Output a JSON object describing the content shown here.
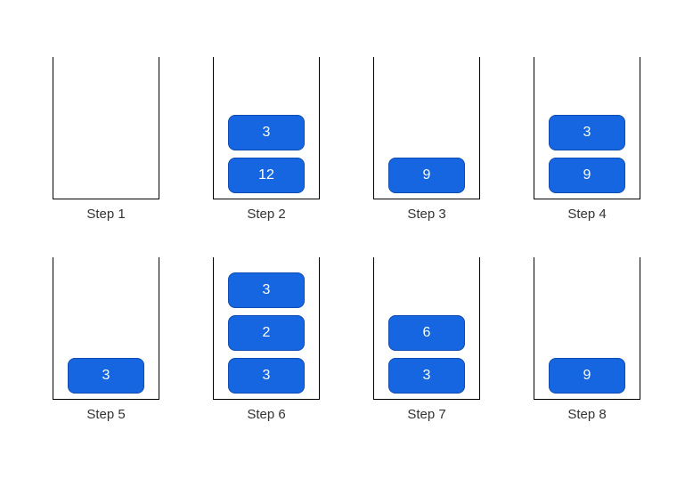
{
  "steps": [
    {
      "label": "Step 1",
      "stack": []
    },
    {
      "label": "Step 2",
      "stack": [
        12,
        3
      ]
    },
    {
      "label": "Step 3",
      "stack": [
        9
      ]
    },
    {
      "label": "Step 4",
      "stack": [
        9,
        3
      ]
    },
    {
      "label": "Step 5",
      "stack": [
        3
      ]
    },
    {
      "label": "Step 6",
      "stack": [
        3,
        2,
        3
      ]
    },
    {
      "label": "Step 7",
      "stack": [
        3,
        6
      ]
    },
    {
      "label": "Step 8",
      "stack": [
        9
      ]
    }
  ],
  "colors": {
    "block": "#1566e0",
    "blockBorder": "#0f4bb0"
  }
}
